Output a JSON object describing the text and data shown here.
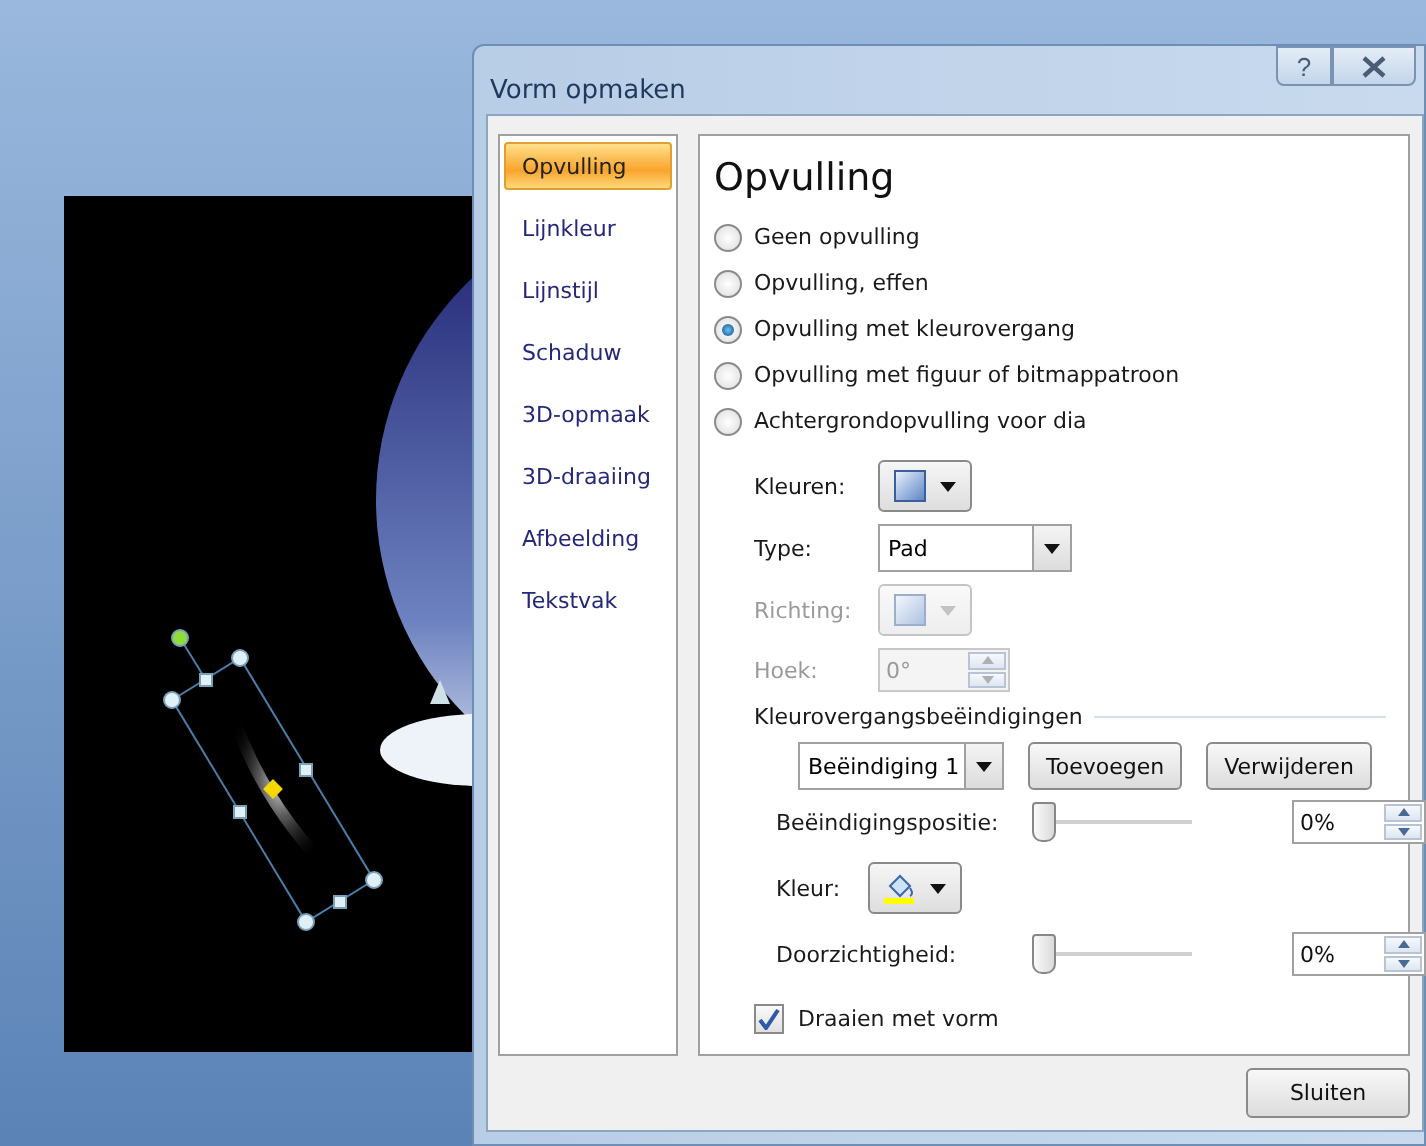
{
  "window": {
    "title": "Vorm opmaken",
    "help": "?"
  },
  "nav": [
    {
      "label": "Opvulling",
      "selected": true
    },
    {
      "label": "Lijnkleur",
      "selected": false
    },
    {
      "label": "Lijnstijl",
      "selected": false
    },
    {
      "label": "Schaduw",
      "selected": false
    },
    {
      "label": "3D-opmaak",
      "selected": false
    },
    {
      "label": "3D-draaiing",
      "selected": false
    },
    {
      "label": "Afbeelding",
      "selected": false
    },
    {
      "label": "Tekstvak",
      "selected": false
    }
  ],
  "heading": "Opvulling",
  "fill_options": [
    {
      "label": "Geen opvulling",
      "selected": false
    },
    {
      "label": "Opvulling, effen",
      "selected": false
    },
    {
      "label": "Opvulling met kleurovergang",
      "selected": true
    },
    {
      "label": "Opvulling met figuur of bitmappatroon",
      "selected": false
    },
    {
      "label": "Achtergrondopvulling voor dia",
      "selected": false
    }
  ],
  "gradient": [
    {
      "kind": "swatch",
      "label": "Kleuren:",
      "disabled": false
    },
    {
      "kind": "dropdown",
      "label": "Type:",
      "value": "Pad",
      "disabled": false
    },
    {
      "kind": "swatch",
      "label": "Richting:",
      "disabled": true
    },
    {
      "kind": "spin",
      "label": "Hoek:",
      "value": "0°",
      "disabled": true
    }
  ],
  "stops": {
    "title": "Kleurovergangsbeëindigingen",
    "stop": "Beëindiging 1",
    "buttons": [
      "Toevoegen",
      "Verwijderen"
    ],
    "rows": [
      {
        "kind": "slider",
        "label": "Beëindigingspositie:",
        "level": 0,
        "reading": "0%"
      },
      {
        "kind": "color",
        "label": "Kleur:"
      },
      {
        "kind": "slider",
        "label": "Doorzichtigheid:",
        "level": 0,
        "reading": "0%"
      }
    ]
  },
  "rotate": {
    "label": "Draaien met vorm",
    "checked": true
  },
  "close_button": "Sluiten"
}
